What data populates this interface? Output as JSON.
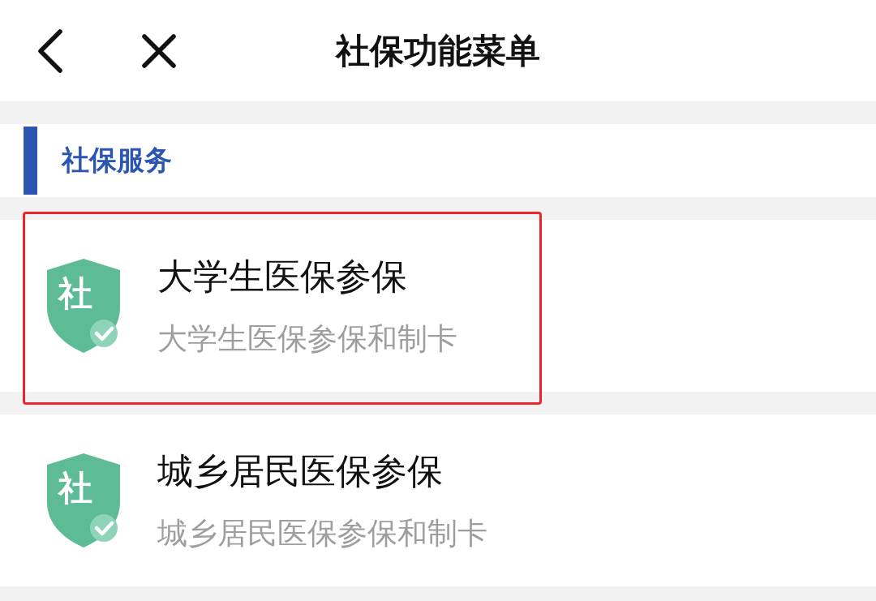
{
  "header": {
    "title": "社保功能菜单"
  },
  "section": {
    "title": "社保服务"
  },
  "items": [
    {
      "icon_text": "社",
      "title": "大学生医保参保",
      "subtitle": "大学生医保参保和制卡",
      "highlighted": true
    },
    {
      "icon_text": "社",
      "title": "城乡居民医保参保",
      "subtitle": "城乡居民医保参保和制卡",
      "highlighted": false
    }
  ]
}
